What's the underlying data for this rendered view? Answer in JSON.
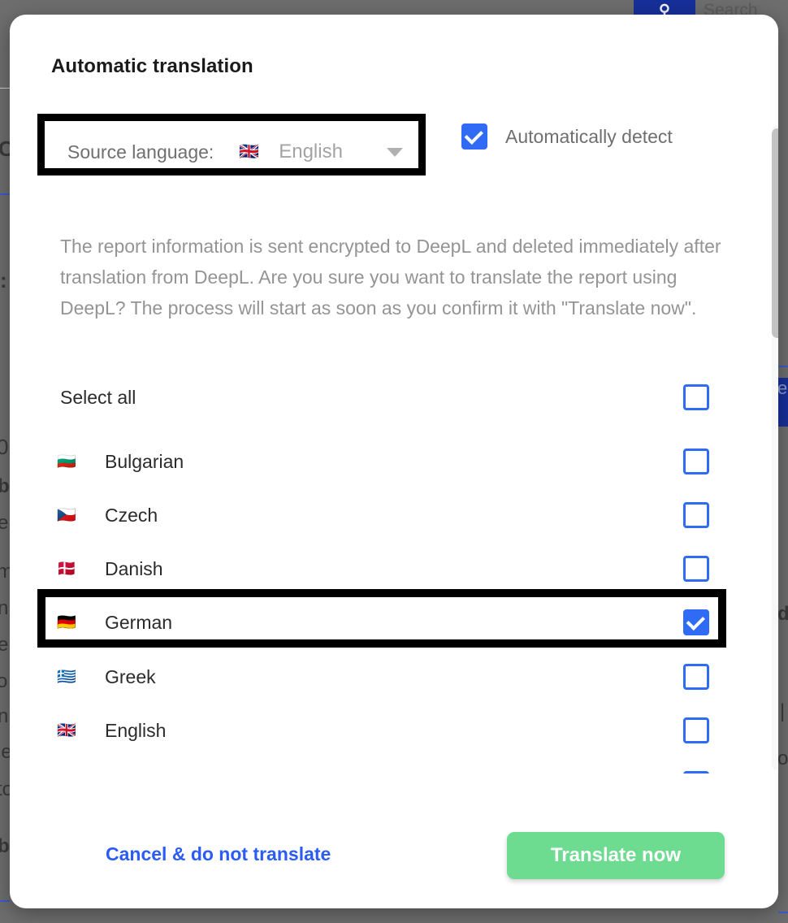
{
  "backdrop": {
    "search_icon": "search-icon",
    "search_label": "Search",
    "side_fragment": "e",
    "left_fragments": [
      "C",
      ":",
      "0",
      "b",
      "e",
      "m",
      "n",
      "e",
      "o",
      "n",
      "le",
      "to",
      "b"
    ],
    "right_fragments": [
      "d",
      "|",
      "o"
    ]
  },
  "modal": {
    "title": "Automatic translation",
    "source_language": {
      "label": "Source language:",
      "flag": "🇬🇧",
      "value": "English",
      "caret_icon": "chevron-down-icon"
    },
    "auto_detect": {
      "label": "Automatically detect",
      "checked": true
    },
    "description": "The report information is sent encrypted to DeepL and deleted immediately after translation from DeepL. Are you sure you want to translate the report using DeepL? The process will start as soon as you confirm it with \"Translate now\".",
    "select_all": {
      "label": "Select all",
      "checked": false
    },
    "languages": [
      {
        "flag": "🇧🇬",
        "label": "Bulgarian",
        "checked": false,
        "highlighted": false
      },
      {
        "flag": "🇨🇿",
        "label": "Czech",
        "checked": false,
        "highlighted": false
      },
      {
        "flag": "🇩🇰",
        "label": "Danish",
        "checked": false,
        "highlighted": false
      },
      {
        "flag": "🇩🇪",
        "label": "German",
        "checked": true,
        "highlighted": true
      },
      {
        "flag": "🇬🇷",
        "label": "Greek",
        "checked": false,
        "highlighted": false
      },
      {
        "flag": "🇬🇧",
        "label": "English",
        "checked": false,
        "highlighted": false
      }
    ],
    "footer": {
      "cancel_label": "Cancel & do not translate",
      "translate_label": "Translate now"
    },
    "scrollbar": {
      "thumb_top_pct": 0,
      "thumb_height_pct": 32
    }
  },
  "colors": {
    "accent_blue": "#2f6bf5",
    "link_blue": "#2b5cf6",
    "primary_green": "#6ddb90",
    "highlight_black": "#000000",
    "muted_text": "#949494",
    "backdrop_dim": "#6e6e6e"
  }
}
